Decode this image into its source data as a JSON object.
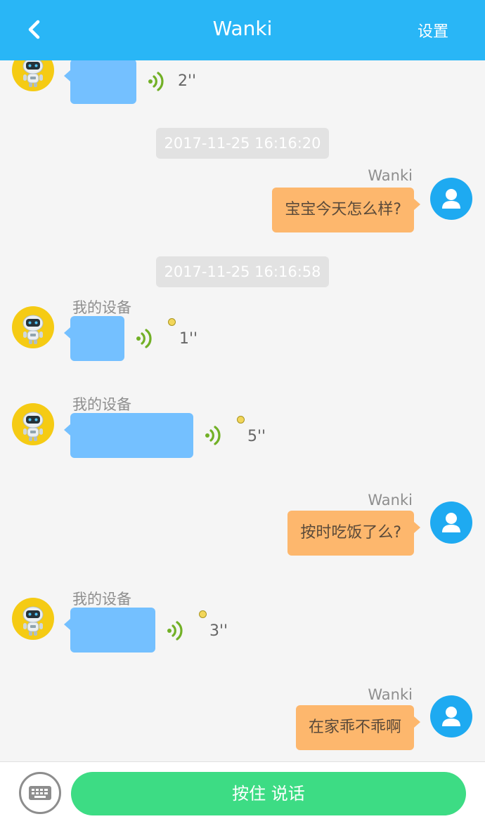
{
  "header": {
    "title": "Wanki",
    "settings_label": "设置",
    "color": "#29b6f6"
  },
  "messages": [
    {
      "type": "voice",
      "side": "left",
      "sender": "",
      "duration": "2''",
      "unread": false
    },
    {
      "type": "timestamp",
      "text": "2017-11-25 16:16:20"
    },
    {
      "type": "text",
      "side": "right",
      "sender": "Wanki",
      "text": "宝宝今天怎么样?"
    },
    {
      "type": "timestamp",
      "text": "2017-11-25 16:16:58"
    },
    {
      "type": "voice",
      "side": "left",
      "sender": "我的设备",
      "duration": "1''",
      "unread": true
    },
    {
      "type": "voice",
      "side": "left",
      "sender": "我的设备",
      "duration": "5''",
      "unread": true
    },
    {
      "type": "text",
      "side": "right",
      "sender": "Wanki",
      "text": "按时吃饭了么?"
    },
    {
      "type": "voice",
      "side": "left",
      "sender": "我的设备",
      "duration": "3''",
      "unread": true
    },
    {
      "type": "text",
      "side": "right",
      "sender": "Wanki",
      "text": "在家乖不乖啊"
    }
  ],
  "footer": {
    "talk_button_label": "按住 说话",
    "keyboard_icon": "keyboard-icon"
  },
  "colors": {
    "voice_bubble": "#74c0ff",
    "text_bubble": "#fdb76d",
    "talk_button": "#3ddc84"
  }
}
